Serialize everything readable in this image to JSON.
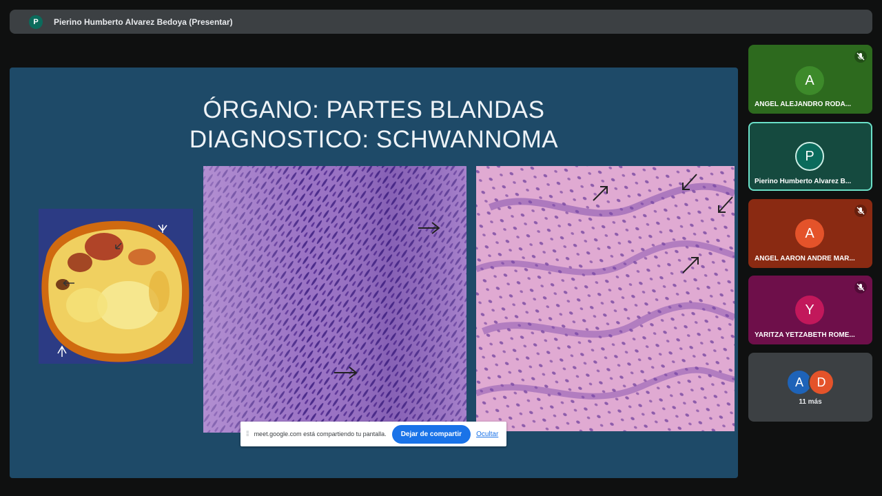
{
  "topbar": {
    "avatar_initial": "P",
    "title": "Pierino Humberto Alvarez Bedoya (Presentar)"
  },
  "slide": {
    "title_line1": "ÓRGANO: PARTES BLANDAS",
    "title_line2": "DIAGNOSTICO: SCHWANNOMA"
  },
  "share_bar": {
    "message": "meet.google.com está compartiendo tu pantalla.",
    "stop_label": "Dejar de compartir",
    "hide_label": "Ocultar"
  },
  "participants": [
    {
      "initial": "A",
      "name": "ANGEL ALEJANDRO RODA...",
      "muted": true,
      "tile_color": "#2d6a1e",
      "avatar_color": "#3d8a2a"
    },
    {
      "initial": "P",
      "name": "Pierino Humberto Alvarez B...",
      "muted": false,
      "tile_color": "#154a3f",
      "avatar_color": "#0b6b5c"
    },
    {
      "initial": "A",
      "name": "ANGEL AARON ANDRE MAR...",
      "muted": true,
      "tile_color": "#8a2a12",
      "avatar_color": "#e4532a"
    },
    {
      "initial": "Y",
      "name": "YARITZA YETZABETH ROME...",
      "muted": true,
      "tile_color": "#6e0f4a",
      "avatar_color": "#c2185b"
    }
  ],
  "more": {
    "initials": [
      "A",
      "D"
    ],
    "colors": [
      "#1e63b8",
      "#e4532a"
    ],
    "label": "11 más"
  },
  "colors": {
    "slide_background": "#1e4a68",
    "accent_blue": "#1a73e8"
  }
}
